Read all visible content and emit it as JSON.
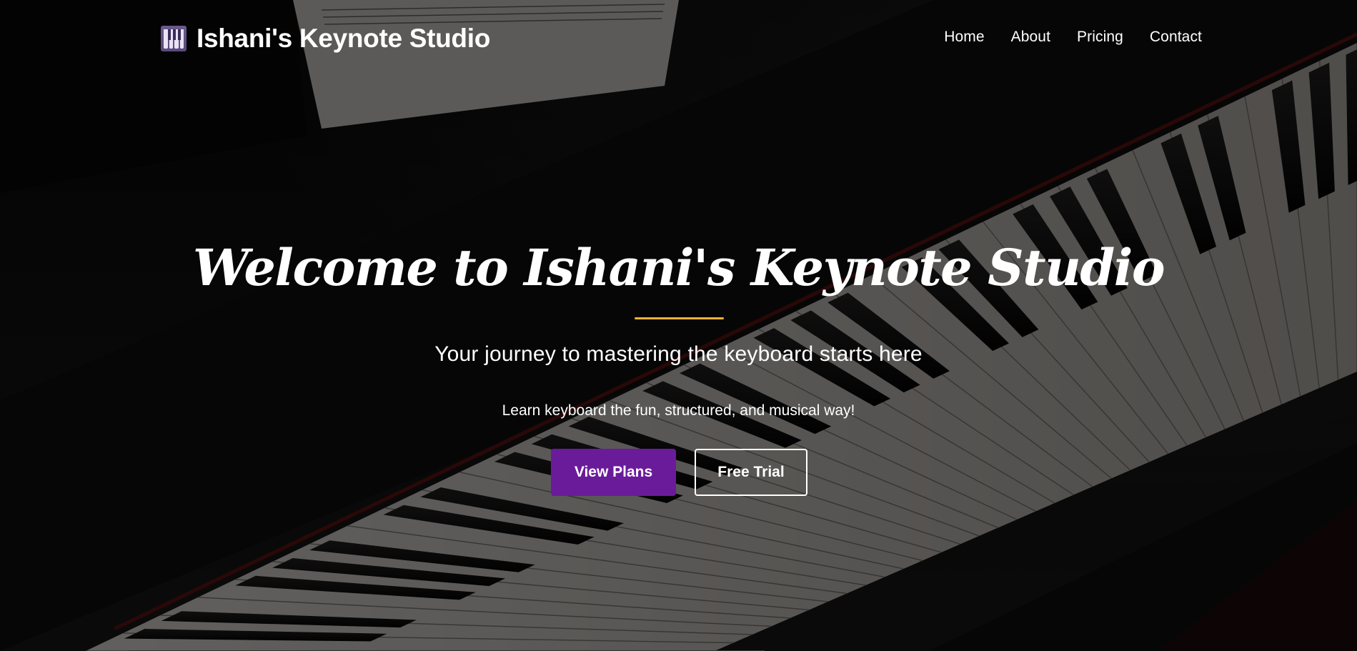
{
  "header": {
    "brand_icon": "piano-keys-icon",
    "brand_name": "Ishani's Keynote Studio",
    "nav": [
      {
        "label": "Home"
      },
      {
        "label": "About"
      },
      {
        "label": "Pricing"
      },
      {
        "label": "Contact"
      }
    ]
  },
  "hero": {
    "background": "piano-keyboard-photo",
    "title": "Welcome to Ishani's Keynote Studio",
    "subtitle": "Your journey to mastering the keyboard starts here",
    "tagline": "Learn keyboard the fun, structured, and musical way!",
    "primary_cta": "View Plans",
    "secondary_cta": "Free Trial"
  },
  "colors": {
    "primary": "#6a1b9a",
    "accent": "#f4b331",
    "text": "#ffffff",
    "overlay": "#000000"
  }
}
